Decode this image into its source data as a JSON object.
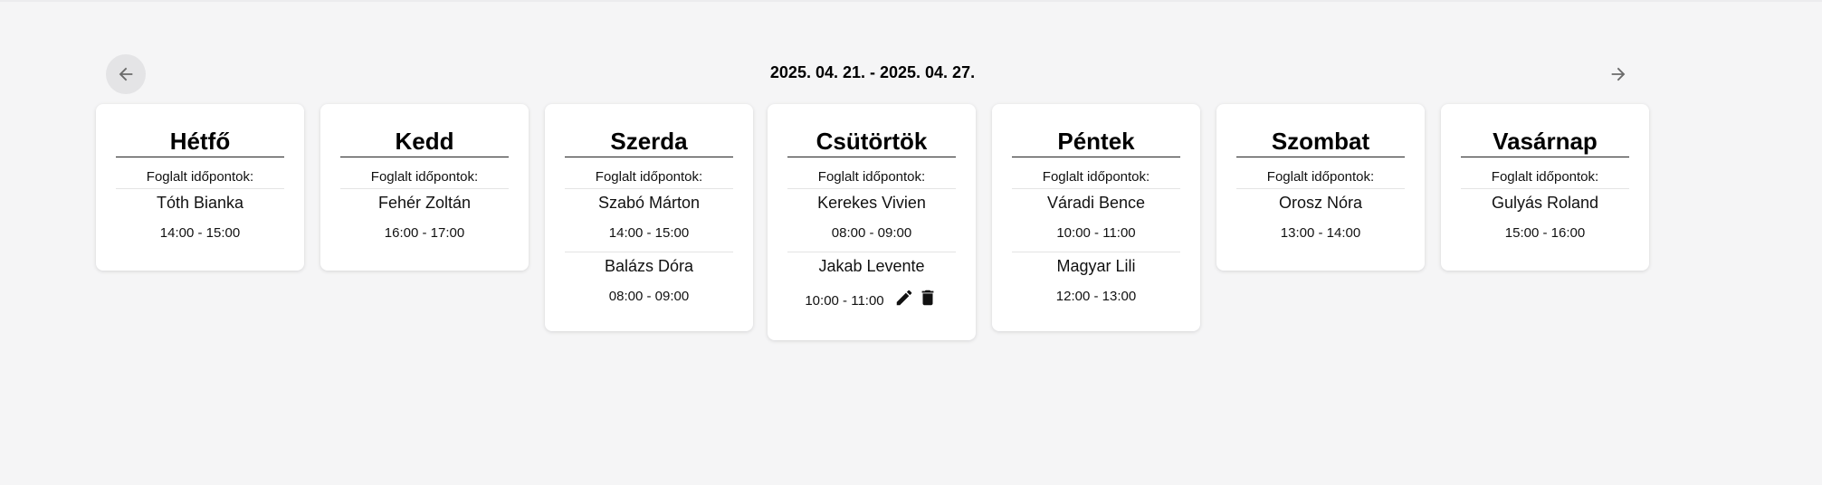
{
  "header": {
    "week_range": "2025. 04. 21. - 2025. 04. 27.",
    "prev_icon": "arrow-left-icon",
    "next_icon": "arrow-right-icon"
  },
  "booked_label": "Foglalt időpontok:",
  "days": [
    {
      "name": "Hétfő",
      "bookings": [
        {
          "name": "Tóth Bianka",
          "time": "14:00 - 15:00"
        }
      ]
    },
    {
      "name": "Kedd",
      "bookings": [
        {
          "name": "Fehér Zoltán",
          "time": "16:00 - 17:00"
        }
      ]
    },
    {
      "name": "Szerda",
      "bookings": [
        {
          "name": "Szabó Márton",
          "time": "14:00 - 15:00"
        },
        {
          "name": "Balázs Dóra",
          "time": "08:00 - 09:00"
        }
      ]
    },
    {
      "name": "Csütörtök",
      "bookings": [
        {
          "name": "Kerekes Vivien",
          "time": "08:00 - 09:00"
        },
        {
          "name": "Jakab Levente",
          "time": "10:00 - 11:00",
          "actions": [
            "pencil-icon",
            "trash-icon"
          ]
        }
      ]
    },
    {
      "name": "Péntek",
      "bookings": [
        {
          "name": "Váradi Bence",
          "time": "10:00 - 11:00"
        },
        {
          "name": "Magyar Lili",
          "time": "12:00 - 13:00"
        }
      ]
    },
    {
      "name": "Szombat",
      "bookings": [
        {
          "name": "Orosz Nóra",
          "time": "13:00 - 14:00"
        }
      ]
    },
    {
      "name": "Vasárnap",
      "bookings": [
        {
          "name": "Gulyás Roland",
          "time": "15:00 - 16:00"
        }
      ]
    }
  ]
}
